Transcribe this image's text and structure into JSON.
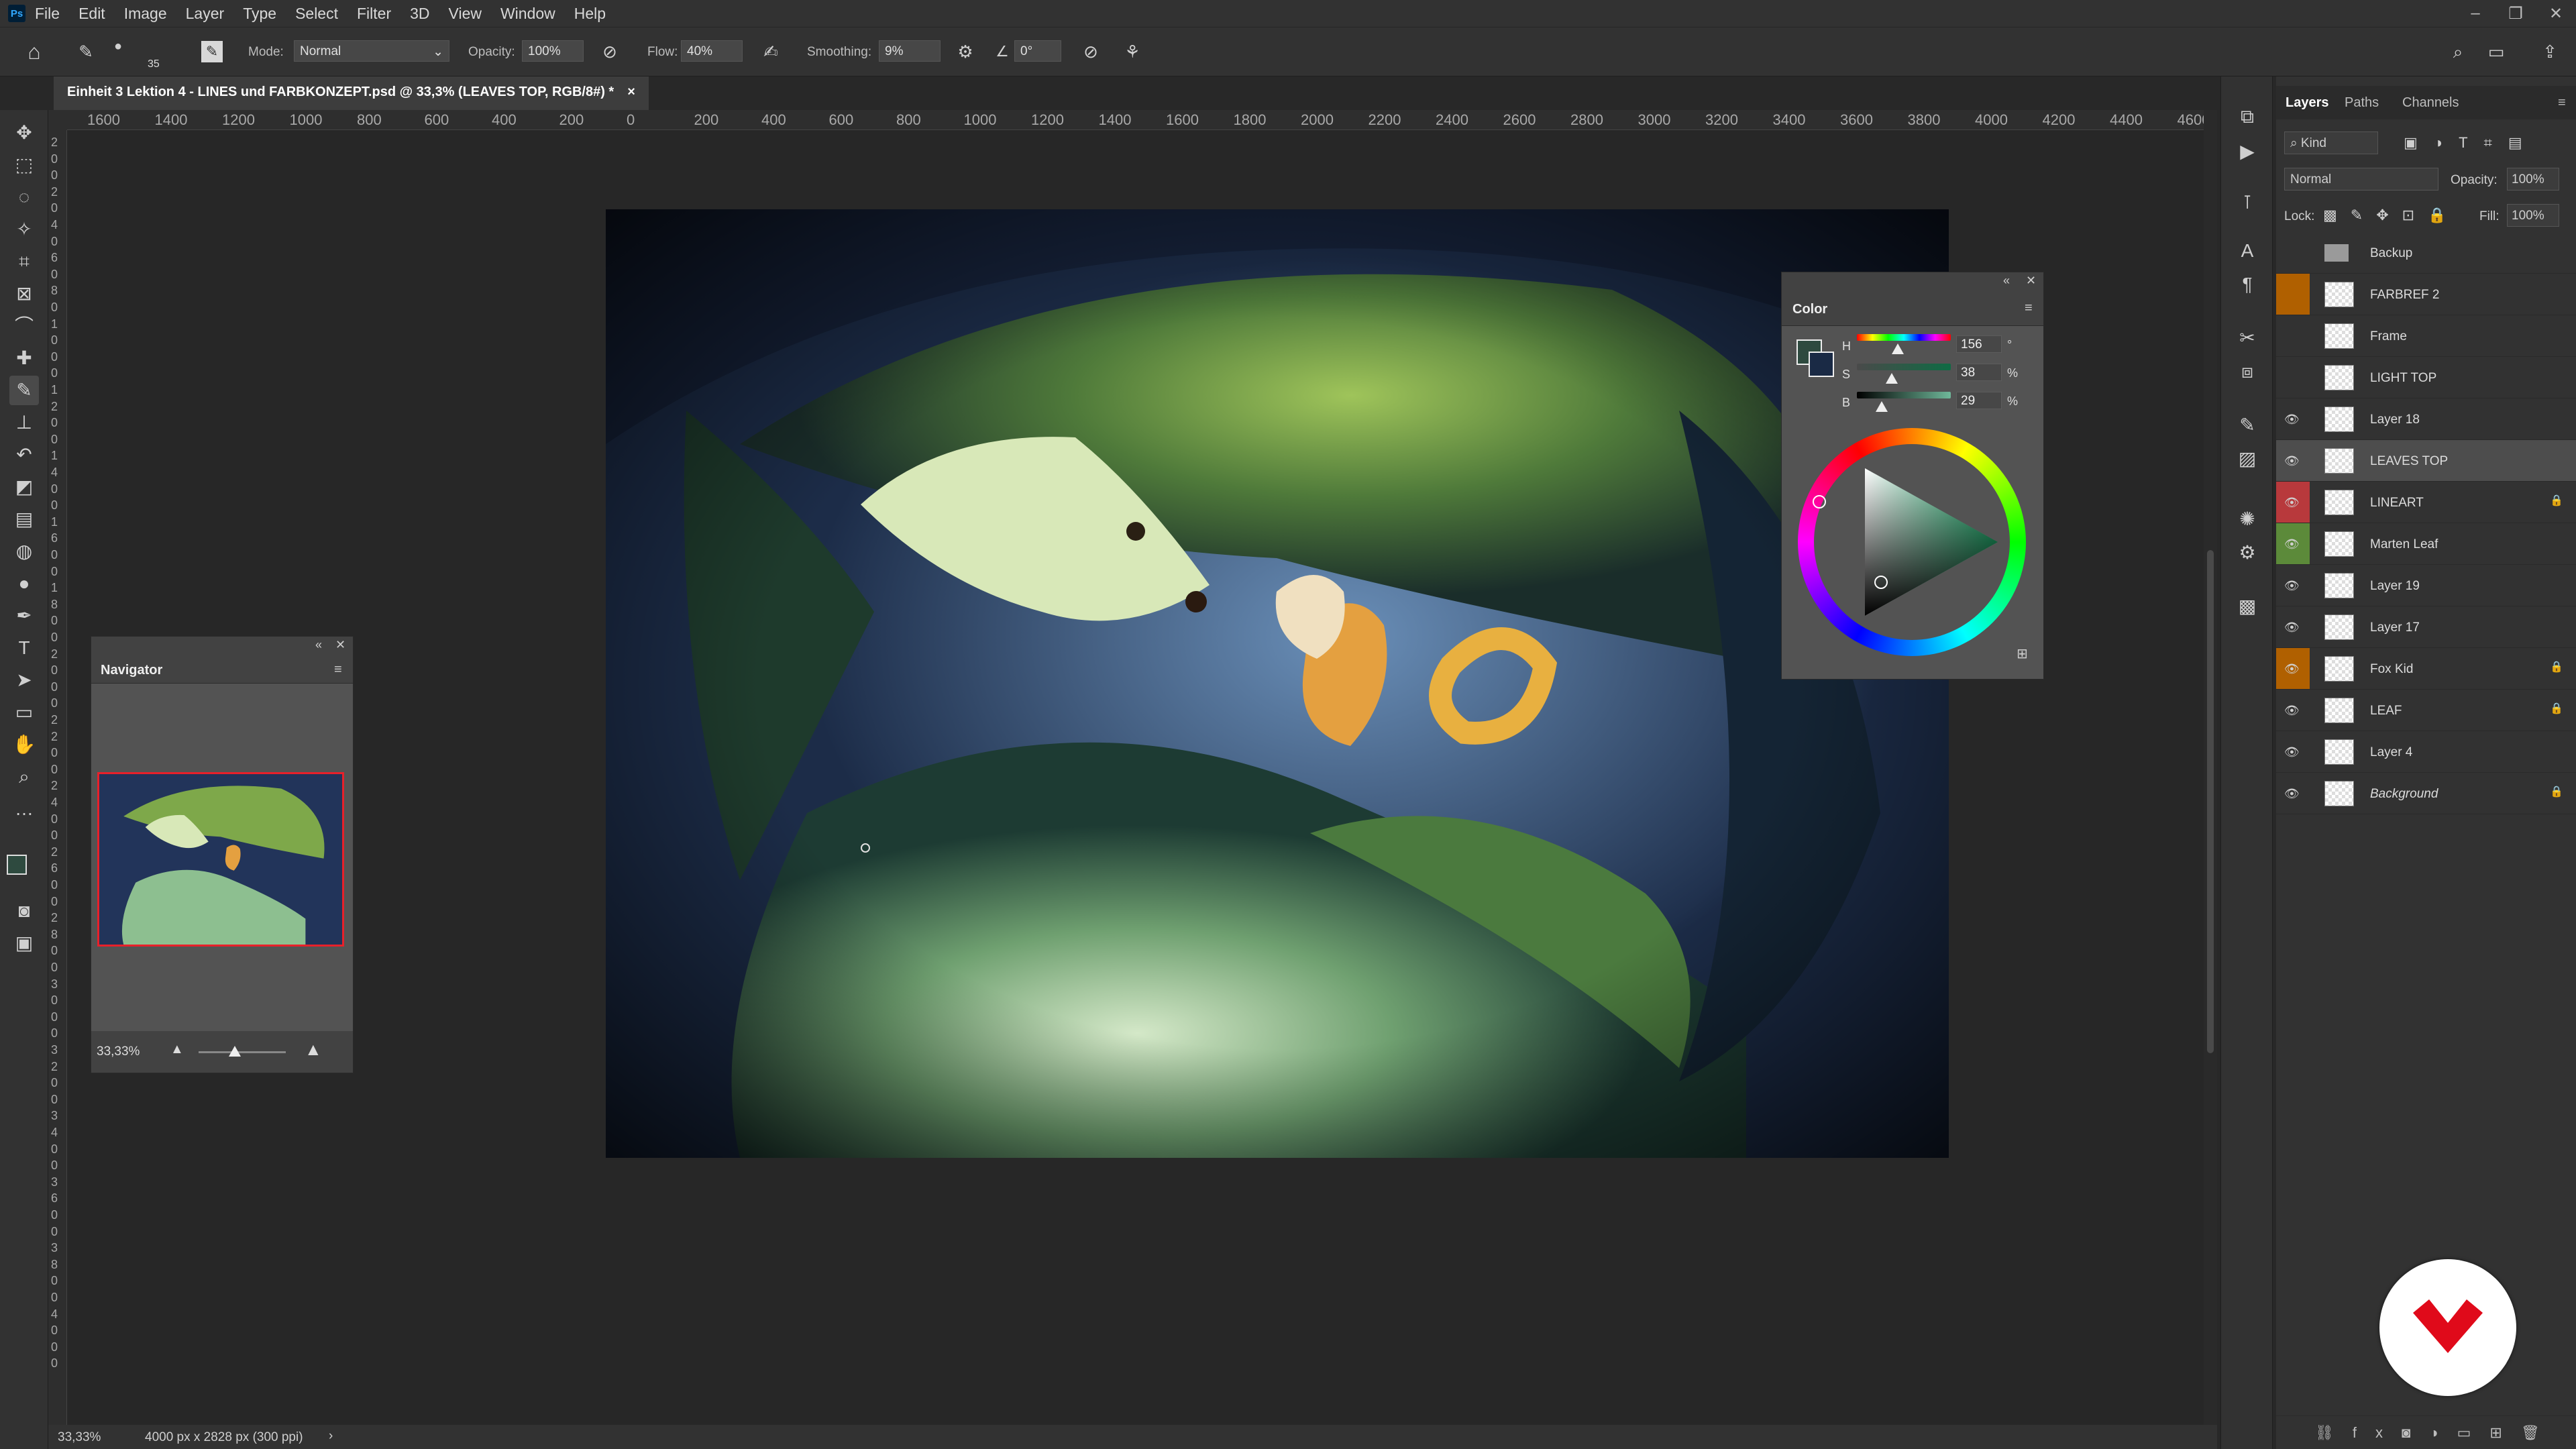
{
  "menu": {
    "app_badge": "Ps",
    "items": [
      "File",
      "Edit",
      "Image",
      "Layer",
      "Type",
      "Select",
      "Filter",
      "3D",
      "View",
      "Window",
      "Help"
    ]
  },
  "options": {
    "brush_size": "35",
    "mode_label": "Mode:",
    "mode_value": "Normal",
    "opacity_label": "Opacity:",
    "opacity_value": "100%",
    "flow_label": "Flow:",
    "flow_value": "40%",
    "smoothing_label": "Smoothing:",
    "smoothing_value": "9%",
    "angle_value": "0°"
  },
  "document": {
    "tab_title": "Einheit 3 Lektion 4 - LINES und FARBKONZEPT.psd @ 33,3% (LEAVES TOP, RGB/8#) *",
    "close": "×"
  },
  "ruler": {
    "h_labels": [
      "1600",
      "1400",
      "1200",
      "1000",
      "800",
      "600",
      "400",
      "200",
      "0",
      "200",
      "400",
      "600",
      "800",
      "1000",
      "1200",
      "1400",
      "1600",
      "1800",
      "2000",
      "2200",
      "2400",
      "2600",
      "2800",
      "3000",
      "3200",
      "3400",
      "3600",
      "3800",
      "4000",
      "4200",
      "4400",
      "4600"
    ],
    "v_labels": [
      "2",
      "0",
      "0",
      "2",
      "0",
      "4",
      "0",
      "6",
      "0",
      "8",
      "0",
      "1",
      "0",
      "0",
      "0",
      "1",
      "2",
      "0",
      "0",
      "1",
      "4",
      "0",
      "0",
      "1",
      "6",
      "0",
      "0",
      "1",
      "8",
      "0",
      "0",
      "2",
      "0",
      "0",
      "0",
      "2",
      "2",
      "0",
      "0",
      "2",
      "4",
      "0",
      "0",
      "2",
      "6",
      "0",
      "0",
      "2",
      "8",
      "0",
      "0",
      "3",
      "0",
      "0",
      "0",
      "3",
      "2",
      "0",
      "0",
      "3",
      "4",
      "0",
      "0",
      "3",
      "6",
      "0",
      "0",
      "3",
      "8",
      "0",
      "0",
      "4",
      "0",
      "0",
      "0"
    ]
  },
  "status": {
    "zoom": "33,33%",
    "doc_info": "4000 px x 2828 px (300 ppi)"
  },
  "navigator": {
    "title": "Navigator",
    "zoom": "33,33%"
  },
  "color": {
    "title": "Color",
    "h_label": "H",
    "h_value": "156",
    "h_unit": "°",
    "s_label": "S",
    "s_value": "38",
    "s_unit": "%",
    "b_label": "B",
    "b_value": "29",
    "b_unit": "%",
    "foreground": "#2e4a3f",
    "background": "#1a2a45"
  },
  "layers": {
    "tabs": [
      "Layers",
      "Paths",
      "Channels"
    ],
    "kind_label": "Kind",
    "blend_mode": "Normal",
    "opacity_label": "Opacity:",
    "opacity_value": "100%",
    "lock_label": "Lock:",
    "fill_label": "Fill:",
    "fill_value": "100%",
    "items": [
      {
        "name": "Backup",
        "visible": false,
        "group": true,
        "color": "",
        "locked": false
      },
      {
        "name": "FARBREF 2",
        "visible": false,
        "group": false,
        "color": "#b06000",
        "locked": false
      },
      {
        "name": "Frame",
        "visible": false,
        "group": false,
        "color": "",
        "locked": false
      },
      {
        "name": "LIGHT TOP",
        "visible": false,
        "group": false,
        "color": "",
        "locked": false
      },
      {
        "name": "Layer 18",
        "visible": true,
        "group": false,
        "color": "",
        "locked": false
      },
      {
        "name": "LEAVES TOP",
        "visible": true,
        "group": false,
        "color": "",
        "locked": false,
        "selected": true
      },
      {
        "name": "LINEART",
        "visible": true,
        "group": false,
        "color": "#b8393c",
        "locked": true
      },
      {
        "name": "Marten Leaf",
        "visible": true,
        "group": false,
        "color": "#5c8a3a",
        "locked": false
      },
      {
        "name": "Layer 19",
        "visible": true,
        "group": false,
        "color": "",
        "locked": false
      },
      {
        "name": "Layer 17",
        "visible": true,
        "group": false,
        "color": "",
        "locked": false
      },
      {
        "name": "Fox Kid",
        "visible": true,
        "group": false,
        "color": "#b06000",
        "locked": true
      },
      {
        "name": "LEAF",
        "visible": true,
        "group": false,
        "color": "",
        "locked": true
      },
      {
        "name": "Layer 4",
        "visible": true,
        "group": false,
        "color": "",
        "locked": false
      },
      {
        "name": "Background",
        "visible": true,
        "group": false,
        "color": "",
        "locked": true,
        "italic": true
      }
    ]
  }
}
